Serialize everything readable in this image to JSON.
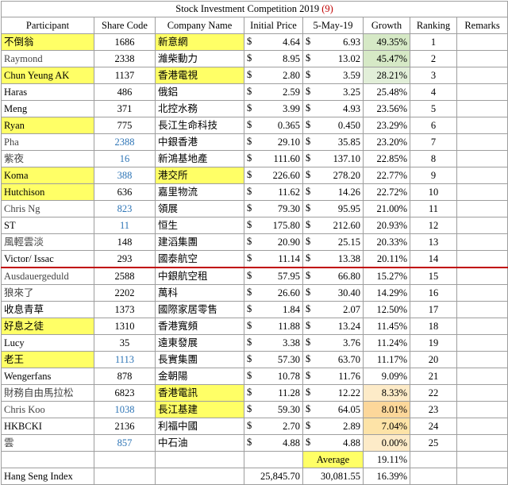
{
  "title": "Stock Investment Competition 2019",
  "title_num": "(9)",
  "headers": [
    "Participant",
    "Share Code",
    "Company Name",
    "Initial Price",
    "5-May-19",
    "Growth",
    "Ranking",
    "Remarks"
  ],
  "currency": "$",
  "rows": [
    {
      "participant": "不倒翁",
      "code": "1686",
      "company": "新意網",
      "initial": "4.64",
      "current": "6.93",
      "growth": "49.35%",
      "rank": "1",
      "hl_p": true,
      "hl_c": true,
      "code_blue": false,
      "g": "g1"
    },
    {
      "participant": "Raymond",
      "code": "2338",
      "company": "濰柴動力",
      "initial": "8.95",
      "current": "13.02",
      "growth": "45.47%",
      "rank": "2",
      "hl_p": false,
      "hl_c": false,
      "code_blue": false,
      "g": "g1",
      "p_gray": true
    },
    {
      "participant": "Chun Yeung AK",
      "code": "1137",
      "company": "香港電視",
      "initial": "2.80",
      "current": "3.59",
      "growth": "28.21%",
      "rank": "3",
      "hl_p": true,
      "hl_c": true,
      "code_blue": false,
      "g": "g2"
    },
    {
      "participant": "Haras",
      "code": "486",
      "company": "俄鋁",
      "initial": "2.59",
      "current": "3.25",
      "growth": "25.48%",
      "rank": "4",
      "hl_p": false,
      "hl_c": false,
      "code_blue": false,
      "g": ""
    },
    {
      "participant": "Meng",
      "code": "371",
      "company": "北控水務",
      "initial": "3.99",
      "current": "4.93",
      "growth": "23.56%",
      "rank": "5",
      "hl_p": false,
      "hl_c": false,
      "code_blue": false,
      "g": ""
    },
    {
      "participant": "Ryan",
      "code": "775",
      "company": "長江生命科技",
      "initial": "0.365",
      "current": "0.450",
      "growth": "23.29%",
      "rank": "6",
      "hl_p": true,
      "hl_c": false,
      "code_blue": false,
      "g": ""
    },
    {
      "participant": "Pha",
      "code": "2388",
      "company": "中銀香港",
      "initial": "29.10",
      "current": "35.85",
      "growth": "23.20%",
      "rank": "7",
      "hl_p": false,
      "hl_c": false,
      "code_blue": true,
      "g": "",
      "p_gray": true
    },
    {
      "participant": "紫夜",
      "code": "16",
      "company": "新鴻基地產",
      "initial": "111.60",
      "current": "137.10",
      "growth": "22.85%",
      "rank": "8",
      "hl_p": false,
      "hl_c": false,
      "code_blue": true,
      "g": "",
      "p_gray": true
    },
    {
      "participant": "Koma",
      "code": "388",
      "company": "港交所",
      "initial": "226.60",
      "current": "278.20",
      "growth": "22.77%",
      "rank": "9",
      "hl_p": true,
      "hl_c": true,
      "code_blue": true,
      "g": ""
    },
    {
      "participant": "Hutchison",
      "code": "636",
      "company": "嘉里物流",
      "initial": "11.62",
      "current": "14.26",
      "growth": "22.72%",
      "rank": "10",
      "hl_p": true,
      "hl_c": false,
      "code_blue": false,
      "g": ""
    },
    {
      "participant": "Chris Ng",
      "code": "823",
      "company": "領展",
      "initial": "79.30",
      "current": "95.95",
      "growth": "21.00%",
      "rank": "11",
      "hl_p": false,
      "hl_c": false,
      "code_blue": true,
      "g": "",
      "p_gray": true
    },
    {
      "participant": "ST",
      "code": "11",
      "company": "恒生",
      "initial": "175.80",
      "current": "212.60",
      "growth": "20.93%",
      "rank": "12",
      "hl_p": false,
      "hl_c": false,
      "code_blue": true,
      "g": ""
    },
    {
      "participant": "風輕雲淡",
      "code": "148",
      "company": "建滔集團",
      "initial": "20.90",
      "current": "25.15",
      "growth": "20.33%",
      "rank": "13",
      "hl_p": false,
      "hl_c": false,
      "code_blue": false,
      "g": "",
      "p_gray": true
    },
    {
      "participant": "Victor/ Issac",
      "code": "293",
      "company": "國泰航空",
      "initial": "11.14",
      "current": "13.38",
      "growth": "20.11%",
      "rank": "14",
      "hl_p": false,
      "hl_c": false,
      "code_blue": false,
      "g": "",
      "cut": true
    },
    {
      "participant": "Ausdauergeduld",
      "code": "2588",
      "company": "中銀航空租",
      "initial": "57.95",
      "current": "66.80",
      "growth": "15.27%",
      "rank": "15",
      "hl_p": false,
      "hl_c": false,
      "code_blue": false,
      "g": "",
      "p_gray": true
    },
    {
      "participant": "狼來了",
      "code": "2202",
      "company": "萬科",
      "initial": "26.60",
      "current": "30.40",
      "growth": "14.29%",
      "rank": "16",
      "hl_p": false,
      "hl_c": false,
      "code_blue": false,
      "g": "",
      "p_gray": true
    },
    {
      "participant": "收息青草",
      "code": "1373",
      "company": "國際家居零售",
      "initial": "1.84",
      "current": "2.07",
      "growth": "12.50%",
      "rank": "17",
      "hl_p": false,
      "hl_c": false,
      "code_blue": false,
      "g": ""
    },
    {
      "participant": "好息之徒",
      "code": "1310",
      "company": "香港寬頻",
      "initial": "11.88",
      "current": "13.24",
      "growth": "11.45%",
      "rank": "18",
      "hl_p": true,
      "hl_c": false,
      "code_blue": false,
      "g": ""
    },
    {
      "participant": "Lucy",
      "code": "35",
      "company": "遠東發展",
      "initial": "3.38",
      "current": "3.76",
      "growth": "11.24%",
      "rank": "19",
      "hl_p": false,
      "hl_c": false,
      "code_blue": false,
      "g": ""
    },
    {
      "participant": "老王",
      "code": "1113",
      "company": "長實集團",
      "initial": "57.30",
      "current": "63.70",
      "growth": "11.17%",
      "rank": "20",
      "hl_p": true,
      "hl_c": false,
      "code_blue": true,
      "g": ""
    },
    {
      "participant": "Wengerfans",
      "code": "878",
      "company": "金朝陽",
      "initial": "10.78",
      "current": "11.76",
      "growth": "9.09%",
      "rank": "21",
      "hl_p": false,
      "hl_c": false,
      "code_blue": false,
      "g": ""
    },
    {
      "participant": "財務自由馬拉松",
      "code": "6823",
      "company": "香港電訊",
      "initial": "11.28",
      "current": "12.22",
      "growth": "8.33%",
      "rank": "22",
      "hl_p": false,
      "hl_c": true,
      "code_blue": false,
      "g": "o3",
      "p_gray": true
    },
    {
      "participant": "Chris Koo",
      "code": "1038",
      "company": "長江基建",
      "initial": "59.30",
      "current": "64.05",
      "growth": "8.01%",
      "rank": "23",
      "hl_p": false,
      "hl_c": true,
      "code_blue": true,
      "g": "o2",
      "p_gray": true
    },
    {
      "participant": "HKBCKI",
      "code": "2136",
      "company": "利福中國",
      "initial": "2.70",
      "current": "2.89",
      "growth": "7.04%",
      "rank": "24",
      "hl_p": false,
      "hl_c": false,
      "code_blue": false,
      "g": "o1"
    },
    {
      "participant": "雲",
      "code": "857",
      "company": "中石油",
      "initial": "4.88",
      "current": "4.88",
      "growth": "0.00%",
      "rank": "25",
      "hl_p": false,
      "hl_c": false,
      "code_blue": true,
      "g": "o3",
      "p_gray": true
    }
  ],
  "average": {
    "label": "Average",
    "value": "19.11%"
  },
  "index": {
    "label": "Hang Seng Index",
    "initial": "25,845.70",
    "current": "30,081.55",
    "growth": "16.39%"
  }
}
